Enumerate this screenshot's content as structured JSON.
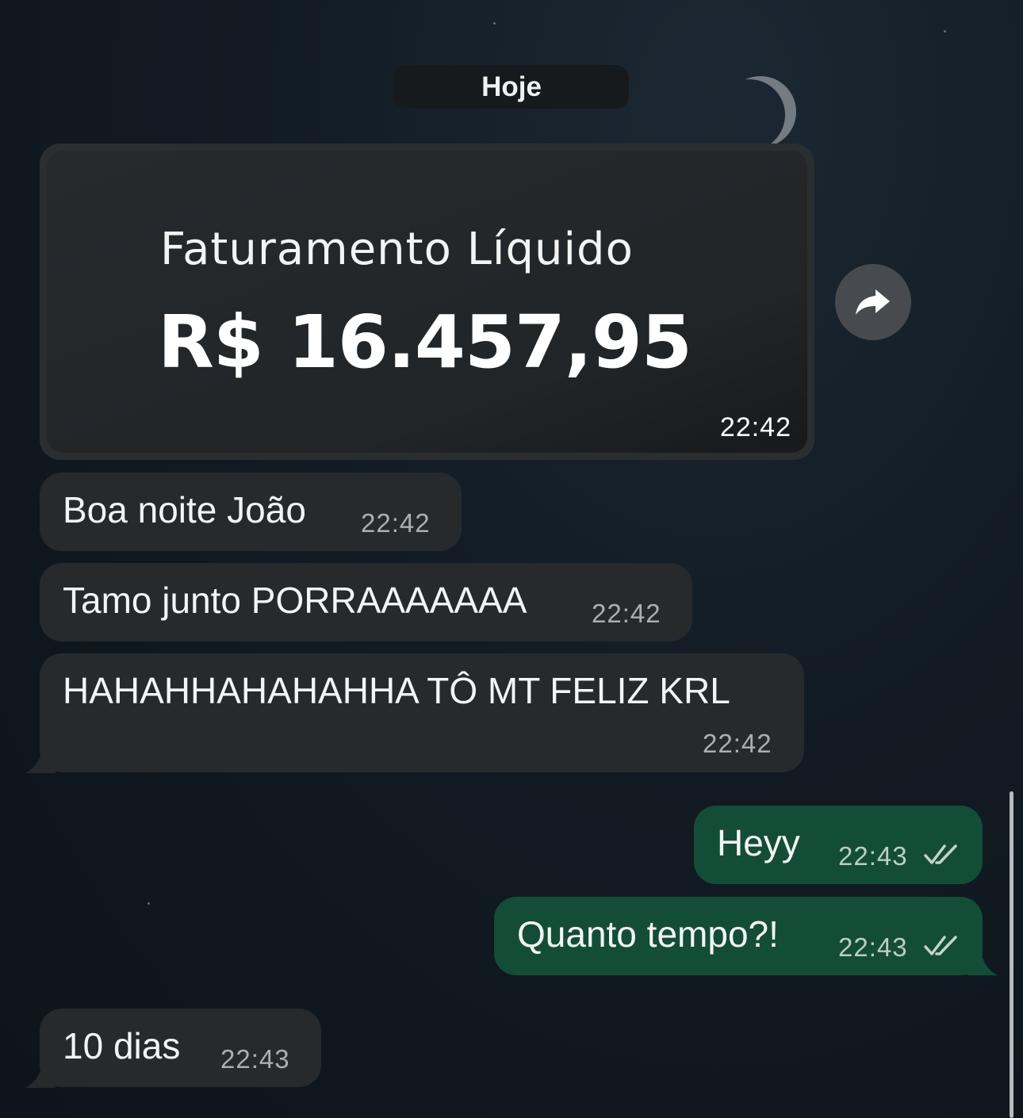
{
  "chat": {
    "date_label": "Hoje",
    "media_message": {
      "label": "Faturamento Líquido",
      "value": "R$ 16.457,95",
      "time": "22:42"
    },
    "messages": [
      {
        "direction": "incoming",
        "text": "Boa noite João",
        "time": "22:42"
      },
      {
        "direction": "incoming",
        "text": "Tamo junto PORRAAAAAAA",
        "time": "22:42"
      },
      {
        "direction": "incoming",
        "text": "HAHAHHAHAHAHHA TÔ MT FELIZ KRL",
        "time": "22:42"
      },
      {
        "direction": "outgoing",
        "text": "Heyy",
        "time": "22:43",
        "status": "read"
      },
      {
        "direction": "outgoing",
        "text": "Quanto tempo?!",
        "time": "22:43",
        "status": "read"
      },
      {
        "direction": "incoming",
        "text": "10 dias",
        "time": "22:43"
      }
    ]
  },
  "icons": {
    "forward": "forward-arrow-icon",
    "read_receipt": "double-check-icon"
  },
  "colors": {
    "incoming_bubble": "#262a2d",
    "outgoing_bubble": "#144d37",
    "read_ticks": "#c4d4cb"
  }
}
